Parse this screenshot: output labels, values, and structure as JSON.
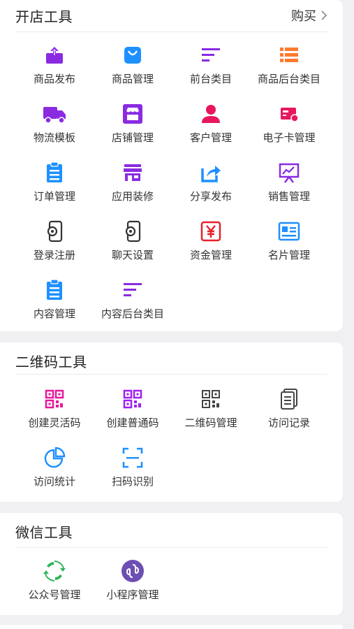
{
  "sections": {
    "shop": {
      "title": "开店工具",
      "buy_label": "购买",
      "items": [
        {
          "label": "商品发布",
          "icon": "upload-box-icon",
          "color": "#8a2be2"
        },
        {
          "label": "商品管理",
          "icon": "shopping-bag-icon",
          "color": "#1e90ff"
        },
        {
          "label": "前台类目",
          "icon": "sort-lines-icon",
          "color": "#8a2be2"
        },
        {
          "label": "商品后台类目",
          "icon": "list-icon",
          "color": "#ff7a2f"
        },
        {
          "label": "物流模板",
          "icon": "truck-icon",
          "color": "#8a2be2"
        },
        {
          "label": "店铺管理",
          "icon": "storefront-icon",
          "color": "#8a2be2"
        },
        {
          "label": "客户管理",
          "icon": "person-icon",
          "color": "#e8175d"
        },
        {
          "label": "电子卡管理",
          "icon": "gift-card-icon",
          "color": "#e8175d"
        },
        {
          "label": "订单管理",
          "icon": "clipboard-icon",
          "color": "#1e90ff"
        },
        {
          "label": "应用装修",
          "icon": "shop-awning-icon",
          "color": "#8a2be2"
        },
        {
          "label": "分享发布",
          "icon": "share-icon",
          "color": "#1e90ff"
        },
        {
          "label": "销售管理",
          "icon": "presentation-chart-icon",
          "color": "#8a2be2"
        },
        {
          "label": "登录注册",
          "icon": "phone-settings-icon",
          "color": "#333333"
        },
        {
          "label": "聊天设置",
          "icon": "phone-settings-icon",
          "color": "#333333"
        },
        {
          "label": "资金管理",
          "icon": "yuan-icon",
          "color": "#e8202a"
        },
        {
          "label": "名片管理",
          "icon": "business-card-icon",
          "color": "#1e90ff"
        },
        {
          "label": "内容管理",
          "icon": "clipboard-icon",
          "color": "#1e90ff"
        },
        {
          "label": "内容后台类目",
          "icon": "sort-lines-icon",
          "color": "#8a2be2"
        }
      ]
    },
    "qr": {
      "title": "二维码工具",
      "items": [
        {
          "label": "创建灵活码",
          "icon": "qr-code-icon",
          "color": "#e8179a"
        },
        {
          "label": "创建普通码",
          "icon": "qr-code-icon",
          "color": "#a020f0"
        },
        {
          "label": "二维码管理",
          "icon": "qr-code-icon",
          "color": "#444444"
        },
        {
          "label": "访问记录",
          "icon": "document-icon",
          "color": "#444444"
        },
        {
          "label": "访问统计",
          "icon": "pie-chart-icon",
          "color": "#1e90ff"
        },
        {
          "label": "扫码识别",
          "icon": "scan-frame-icon",
          "color": "#1e90ff"
        }
      ]
    },
    "wechat": {
      "title": "微信工具",
      "items": [
        {
          "label": "公众号管理",
          "icon": "official-account-icon",
          "color": "#2fb45a"
        },
        {
          "label": "小程序管理",
          "icon": "mini-program-icon",
          "color": "#6c4fb3"
        }
      ]
    }
  }
}
